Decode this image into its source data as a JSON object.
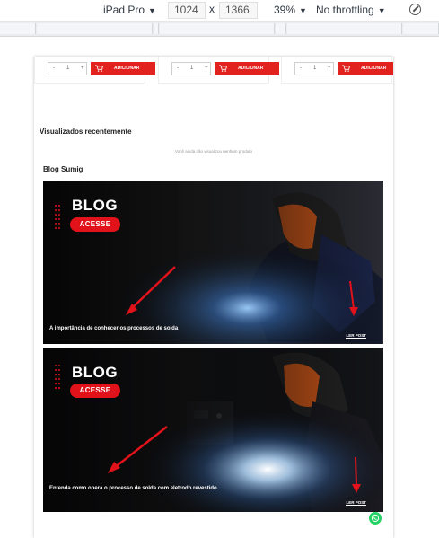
{
  "devtools": {
    "device": "iPad Pro",
    "width": "1024",
    "times": "x",
    "height": "1366",
    "zoom": "39%",
    "throttling": "No throttling",
    "caret": "▼",
    "rotate_icon": "rotate-icon"
  },
  "products": {
    "cards": [
      {
        "qty_minus": "-",
        "qty_value": "1",
        "qty_plus": "+",
        "add_label": "ADICIONAR"
      },
      {
        "qty_minus": "-",
        "qty_value": "1",
        "qty_plus": "+",
        "add_label": "ADICIONAR"
      },
      {
        "qty_minus": "-",
        "qty_value": "1",
        "qty_plus": "+",
        "add_label": "ADICIONAR"
      }
    ]
  },
  "recent": {
    "title": "Visualizados recentemente",
    "empty_text": "Você ainda não visualizou nenhum produto"
  },
  "blog": {
    "title": "Blog Sumig",
    "posts": [
      {
        "heading": "BLOG",
        "button": "ACESSE",
        "caption": "A importância de conhecer os processos de solda",
        "link": "LER POST"
      },
      {
        "heading": "BLOG",
        "button": "ACESSE",
        "caption": "Entenda como opera o processo de solda com eletrodo revestido",
        "link": "LER POST"
      }
    ]
  },
  "colors": {
    "accent": "#e1221f",
    "whatsapp": "#25d366"
  }
}
